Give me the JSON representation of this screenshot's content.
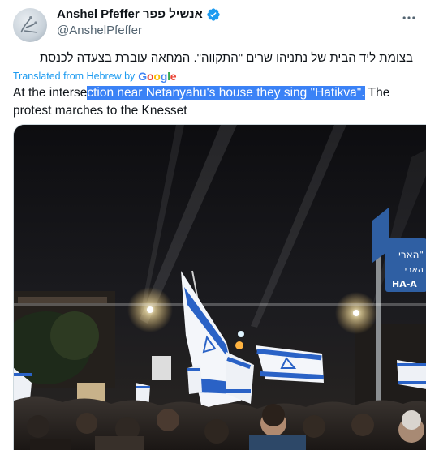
{
  "author": {
    "display_name": "Anshel Pfeffer אנשיל פפר",
    "handle": "@AnshelPfeffer",
    "verified": true
  },
  "tweet": {
    "original_text": "בצומת ליד הבית של נתניהו שרים \"התקווה\". המחאה עוברת בצעדה לכנסת",
    "translated_label": "Translated from Hebrew by",
    "google_letters": [
      "G",
      "o",
      "o",
      "g",
      "l",
      "e"
    ],
    "translation_before": "At the interse",
    "translation_highlighted": "ction near Netanyahu's house they sing \"Hatikva\".",
    "translation_after": " The protest marches to the Knesset"
  },
  "photo": {
    "street_sign_text": "הארי\"",
    "street_sign_text2": "הארי",
    "street_sign_latin": "HA-A"
  },
  "colors": {
    "accent": "#1d9bf0",
    "selection": "#3b82f6",
    "secondary_text": "#536471"
  },
  "icons": {
    "verified": "verified-badge-icon",
    "more": "more-options-icon"
  }
}
